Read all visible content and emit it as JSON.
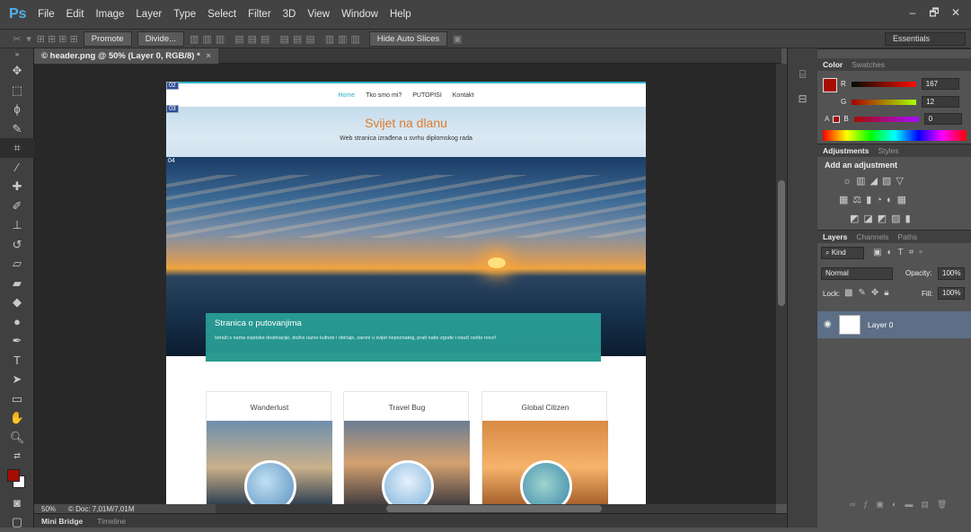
{
  "app": {
    "logo": "Ps"
  },
  "menu": [
    "File",
    "Edit",
    "Image",
    "Layer",
    "Type",
    "Select",
    "Filter",
    "3D",
    "View",
    "Window",
    "Help"
  ],
  "window_controls": [
    "–",
    "🗗",
    "✕"
  ],
  "options": {
    "promote": "Promote",
    "divide": "Divide...",
    "hide_auto_slices": "Hide Auto Slices",
    "workspace": "Essentials"
  },
  "document": {
    "tab_title": "© header.png @ 50% (Layer 0, RGB/8) *",
    "slice_labels": [
      "02",
      "03",
      "04"
    ],
    "nav": [
      "Home",
      "Tko smo mi?",
      "PUTOPISI",
      "Kontakt"
    ],
    "hero_title": "Svijet na dlanu",
    "hero_subtitle": "Web stranica izrađena u svrhu diplomskog rada",
    "banner_title": "Stranica o putovanjima",
    "banner_text": "Istraži s nama svjetske destinacije, doživi razne kulture i običaje, zaroni u svijet nepoznatog, prati naše zgode i nauči nešto novo!",
    "cards": [
      "Wanderlust",
      "Travel Bug",
      "Global Citizen"
    ]
  },
  "status": {
    "zoom": "50%",
    "doc_info": "© Doc: 7,01M/7,01M"
  },
  "bottom_tabs": [
    "Mini Bridge",
    "Timeline"
  ],
  "color_panel": {
    "tabs": [
      "Color",
      "Swatches"
    ],
    "R": "167",
    "G": "12",
    "B": "0",
    "foreground": "#a70c00"
  },
  "adjustments_panel": {
    "tabs": [
      "Adjustments",
      "Styles"
    ],
    "heading": "Add an adjustment"
  },
  "layers_panel": {
    "tabs": [
      "Layers",
      "Channels",
      "Paths"
    ],
    "kind": "Kind",
    "blend": "Normal",
    "opacity_label": "Opacity:",
    "opacity": "100%",
    "lock_label": "Lock:",
    "fill_label": "Fill:",
    "fill": "100%",
    "layer_name": "Layer 0"
  },
  "tools": [
    "move-tool",
    "marquee-tool",
    "lasso-tool",
    "quick-select-tool",
    "crop-tool",
    "eyedropper-tool",
    "healing-tool",
    "brush-tool",
    "stamp-tool",
    "history-brush-tool",
    "eraser-tool",
    "gradient-tool",
    "blur-tool",
    "dodge-tool",
    "pen-tool",
    "type-tool",
    "path-select-tool",
    "shape-tool",
    "hand-tool",
    "zoom-tool"
  ]
}
